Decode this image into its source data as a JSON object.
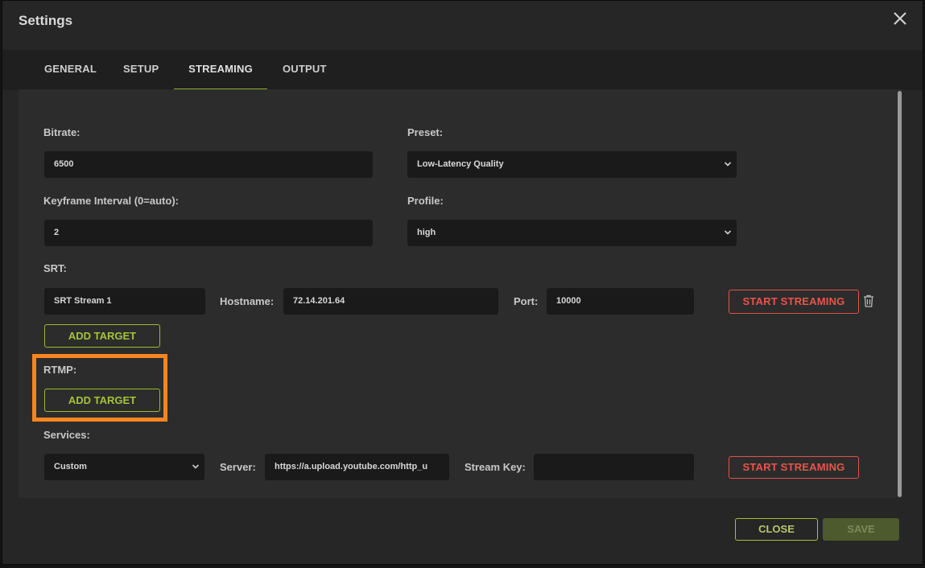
{
  "dialog": {
    "title": "Settings"
  },
  "tabs": [
    {
      "label": "GENERAL",
      "active": false
    },
    {
      "label": "SETUP",
      "active": false
    },
    {
      "label": "STREAMING",
      "active": true
    },
    {
      "label": "OUTPUT",
      "active": false
    }
  ],
  "encoding": {
    "bitrate_label": "Bitrate:",
    "bitrate_value": "6500",
    "preset_label": "Preset:",
    "preset_value": "Low-Latency Quality",
    "keyframe_label": "Keyframe Interval (0=auto):",
    "keyframe_value": "2",
    "profile_label": "Profile:",
    "profile_value": "high"
  },
  "srt": {
    "section_label": "SRT:",
    "stream_name": "SRT Stream 1",
    "hostname_label": "Hostname:",
    "hostname_value": "72.14.201.64",
    "port_label": "Port:",
    "port_value": "10000",
    "start_label": "START STREAMING",
    "add_target_label": "ADD TARGET"
  },
  "rtmp": {
    "section_label": "RTMP:",
    "add_target_label": "ADD TARGET",
    "services_label": "Services:",
    "service_value": "Custom",
    "server_label": "Server:",
    "server_value": "https://a.upload.youtube.com/http_u",
    "stream_key_label": "Stream Key:",
    "stream_key_value": "",
    "start_label": "START STREAMING"
  },
  "footer": {
    "close_label": "CLOSE",
    "save_label": "SAVE"
  },
  "colors": {
    "accent_green": "#9cba2e",
    "accent_red": "#e0534a",
    "highlight_orange": "#f7851f"
  }
}
